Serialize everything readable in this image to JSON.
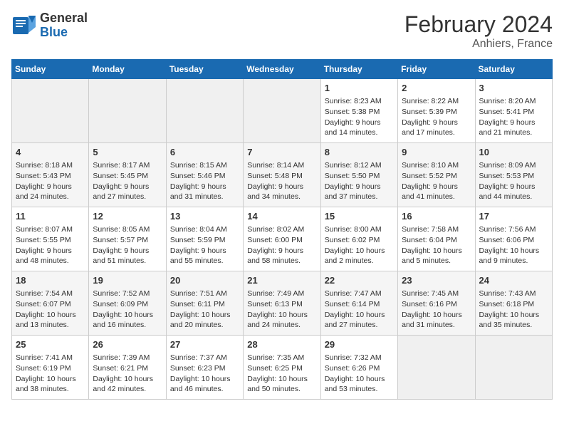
{
  "header": {
    "logo_line1": "General",
    "logo_line2": "Blue",
    "title": "February 2024",
    "subtitle": "Anhiers, France"
  },
  "days_of_week": [
    "Sunday",
    "Monday",
    "Tuesday",
    "Wednesday",
    "Thursday",
    "Friday",
    "Saturday"
  ],
  "weeks": [
    [
      {
        "day": "",
        "info": ""
      },
      {
        "day": "",
        "info": ""
      },
      {
        "day": "",
        "info": ""
      },
      {
        "day": "",
        "info": ""
      },
      {
        "day": "1",
        "info": "Sunrise: 8:23 AM\nSunset: 5:38 PM\nDaylight: 9 hours\nand 14 minutes."
      },
      {
        "day": "2",
        "info": "Sunrise: 8:22 AM\nSunset: 5:39 PM\nDaylight: 9 hours\nand 17 minutes."
      },
      {
        "day": "3",
        "info": "Sunrise: 8:20 AM\nSunset: 5:41 PM\nDaylight: 9 hours\nand 21 minutes."
      }
    ],
    [
      {
        "day": "4",
        "info": "Sunrise: 8:18 AM\nSunset: 5:43 PM\nDaylight: 9 hours\nand 24 minutes."
      },
      {
        "day": "5",
        "info": "Sunrise: 8:17 AM\nSunset: 5:45 PM\nDaylight: 9 hours\nand 27 minutes."
      },
      {
        "day": "6",
        "info": "Sunrise: 8:15 AM\nSunset: 5:46 PM\nDaylight: 9 hours\nand 31 minutes."
      },
      {
        "day": "7",
        "info": "Sunrise: 8:14 AM\nSunset: 5:48 PM\nDaylight: 9 hours\nand 34 minutes."
      },
      {
        "day": "8",
        "info": "Sunrise: 8:12 AM\nSunset: 5:50 PM\nDaylight: 9 hours\nand 37 minutes."
      },
      {
        "day": "9",
        "info": "Sunrise: 8:10 AM\nSunset: 5:52 PM\nDaylight: 9 hours\nand 41 minutes."
      },
      {
        "day": "10",
        "info": "Sunrise: 8:09 AM\nSunset: 5:53 PM\nDaylight: 9 hours\nand 44 minutes."
      }
    ],
    [
      {
        "day": "11",
        "info": "Sunrise: 8:07 AM\nSunset: 5:55 PM\nDaylight: 9 hours\nand 48 minutes."
      },
      {
        "day": "12",
        "info": "Sunrise: 8:05 AM\nSunset: 5:57 PM\nDaylight: 9 hours\nand 51 minutes."
      },
      {
        "day": "13",
        "info": "Sunrise: 8:04 AM\nSunset: 5:59 PM\nDaylight: 9 hours\nand 55 minutes."
      },
      {
        "day": "14",
        "info": "Sunrise: 8:02 AM\nSunset: 6:00 PM\nDaylight: 9 hours\nand 58 minutes."
      },
      {
        "day": "15",
        "info": "Sunrise: 8:00 AM\nSunset: 6:02 PM\nDaylight: 10 hours\nand 2 minutes."
      },
      {
        "day": "16",
        "info": "Sunrise: 7:58 AM\nSunset: 6:04 PM\nDaylight: 10 hours\nand 5 minutes."
      },
      {
        "day": "17",
        "info": "Sunrise: 7:56 AM\nSunset: 6:06 PM\nDaylight: 10 hours\nand 9 minutes."
      }
    ],
    [
      {
        "day": "18",
        "info": "Sunrise: 7:54 AM\nSunset: 6:07 PM\nDaylight: 10 hours\nand 13 minutes."
      },
      {
        "day": "19",
        "info": "Sunrise: 7:52 AM\nSunset: 6:09 PM\nDaylight: 10 hours\nand 16 minutes."
      },
      {
        "day": "20",
        "info": "Sunrise: 7:51 AM\nSunset: 6:11 PM\nDaylight: 10 hours\nand 20 minutes."
      },
      {
        "day": "21",
        "info": "Sunrise: 7:49 AM\nSunset: 6:13 PM\nDaylight: 10 hours\nand 24 minutes."
      },
      {
        "day": "22",
        "info": "Sunrise: 7:47 AM\nSunset: 6:14 PM\nDaylight: 10 hours\nand 27 minutes."
      },
      {
        "day": "23",
        "info": "Sunrise: 7:45 AM\nSunset: 6:16 PM\nDaylight: 10 hours\nand 31 minutes."
      },
      {
        "day": "24",
        "info": "Sunrise: 7:43 AM\nSunset: 6:18 PM\nDaylight: 10 hours\nand 35 minutes."
      }
    ],
    [
      {
        "day": "25",
        "info": "Sunrise: 7:41 AM\nSunset: 6:19 PM\nDaylight: 10 hours\nand 38 minutes."
      },
      {
        "day": "26",
        "info": "Sunrise: 7:39 AM\nSunset: 6:21 PM\nDaylight: 10 hours\nand 42 minutes."
      },
      {
        "day": "27",
        "info": "Sunrise: 7:37 AM\nSunset: 6:23 PM\nDaylight: 10 hours\nand 46 minutes."
      },
      {
        "day": "28",
        "info": "Sunrise: 7:35 AM\nSunset: 6:25 PM\nDaylight: 10 hours\nand 50 minutes."
      },
      {
        "day": "29",
        "info": "Sunrise: 7:32 AM\nSunset: 6:26 PM\nDaylight: 10 hours\nand 53 minutes."
      },
      {
        "day": "",
        "info": ""
      },
      {
        "day": "",
        "info": ""
      }
    ]
  ]
}
